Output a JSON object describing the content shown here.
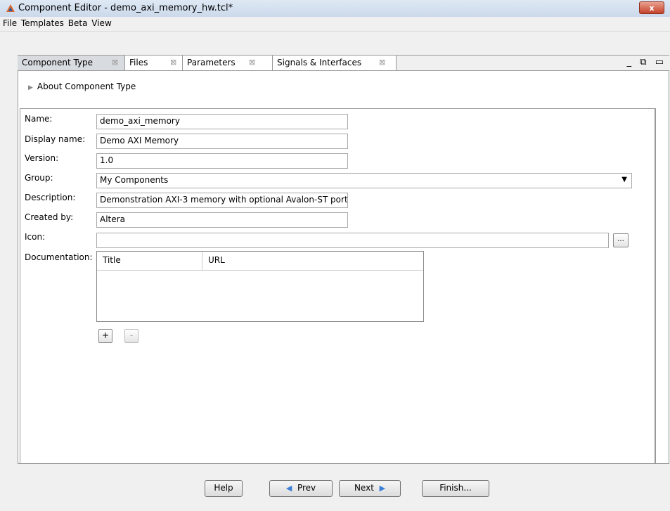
{
  "window": {
    "title": "Component Editor - demo_axi_memory_hw.tcl*",
    "close_label": "x"
  },
  "menu": [
    "File",
    "Templates",
    "Beta",
    "View"
  ],
  "tabs": [
    {
      "label": "Component Type",
      "active": true
    },
    {
      "label": "Files"
    },
    {
      "label": "Parameters"
    },
    {
      "label": "Signals & Interfaces"
    }
  ],
  "tab_close_glyph": "⊠",
  "window_controls": "_ ⧉ ▭",
  "about": {
    "label": "About Component Type"
  },
  "form": {
    "name_label": "Name:",
    "name_value": "demo_axi_memory",
    "display_name_label": "Display name:",
    "display_name_value": "Demo AXI Memory",
    "version_label": "Version:",
    "version_value": "1.0",
    "group_label": "Group:",
    "group_value": "My Components",
    "description_label": "Description:",
    "description_value": "Demonstration AXI-3 memory with optional Avalon-ST port",
    "created_by_label": "Created by:",
    "created_by_value": "Altera",
    "icon_label": "Icon:",
    "icon_value": "",
    "browse_label": "...",
    "documentation_label": "Documentation:",
    "doc_columns": [
      "Title",
      "URL"
    ],
    "add_label": "+",
    "remove_label": "-"
  },
  "footer": {
    "help": "Help",
    "prev": "Prev",
    "next": "Next",
    "finish": "Finish..."
  },
  "colors": {
    "accent": "#3b7fd6",
    "close": "#c5422a"
  }
}
